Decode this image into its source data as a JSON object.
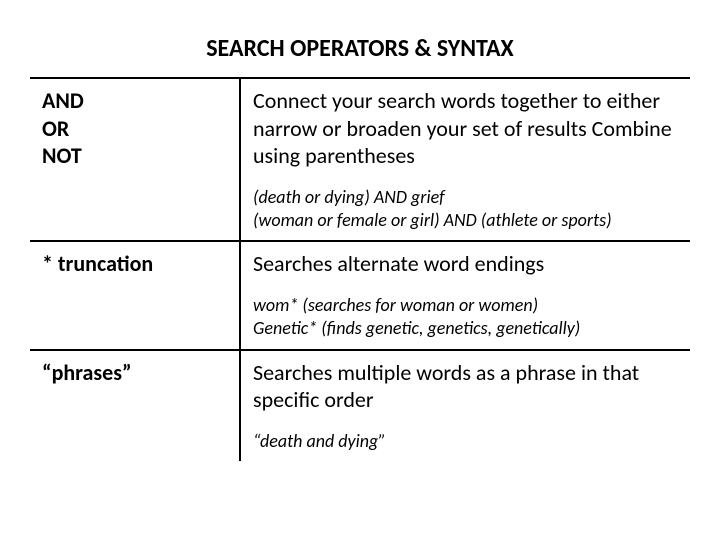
{
  "title": "SEARCH OPERATORS & SYNTAX",
  "rows": [
    {
      "operator_lines": [
        "AND",
        "OR",
        "NOT"
      ],
      "description": "Connect your search words together to either narrow or broaden your set of results Combine using parentheses",
      "examples": [
        "(death or dying) AND grief",
        "(woman or female or girl) AND (athlete or sports)"
      ]
    },
    {
      "operator_lines": [
        "* truncation"
      ],
      "description": "Searches alternate word endings",
      "examples": [
        "wom*  (searches for woman or women)",
        "Genetic* (finds genetic, genetics, genetically)"
      ]
    },
    {
      "operator_lines": [
        "“phrases”"
      ],
      "description": "Searches multiple words as a phrase in that specific order",
      "examples": [
        "“death and dying”"
      ]
    }
  ]
}
